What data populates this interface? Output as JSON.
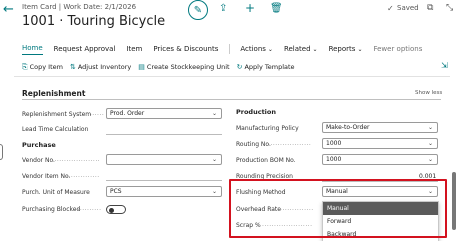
{
  "header": {
    "breadcrumb": "Item Card | Work Date: 2/1/2026",
    "title": "1001 · Touring Bicycle",
    "saved_label": "Saved"
  },
  "actions": {
    "tabs": [
      "Home",
      "Request Approval",
      "Item",
      "Prices & Discounts"
    ],
    "menus": [
      "Actions",
      "Related",
      "Reports"
    ],
    "fewer": "Fewer options"
  },
  "promoted": [
    "Copy Item",
    "Adjust Inventory",
    "Create Stockkeeping Unit",
    "Apply Template"
  ],
  "section": {
    "title": "Replenishment",
    "show_less": "Show less"
  },
  "left": {
    "replenishment_system": {
      "label": "Replenishment System",
      "value": "Prod. Order"
    },
    "lead_time": {
      "label": "Lead Time Calculation"
    },
    "purchase_heading": "Purchase",
    "vendor_no": {
      "label": "Vendor No."
    },
    "vendor_item_no": {
      "label": "Vendor Item No."
    },
    "purch_uom": {
      "label": "Purch. Unit of Measure",
      "value": "PCS"
    },
    "purchasing_blocked": {
      "label": "Purchasing Blocked",
      "value": false
    }
  },
  "right": {
    "production_heading": "Production",
    "manufacturing_policy": {
      "label": "Manufacturing Policy",
      "value": "Make-to-Order"
    },
    "routing_no": {
      "label": "Routing No.",
      "value": "1000"
    },
    "production_bom_no": {
      "label": "Production BOM No.",
      "value": "1000"
    },
    "rounding_precision": {
      "label": "Rounding Precision",
      "value": "0.001"
    },
    "flushing_method": {
      "label": "Flushing Method",
      "value": "Manual"
    },
    "overhead_rate": {
      "label": "Overhead Rate"
    },
    "scrap": {
      "label": "Scrap %"
    }
  },
  "dropdown": {
    "options": [
      "Manual",
      "Forward",
      "Backward"
    ],
    "selected": "Manual"
  },
  "colors": {
    "accent": "#00797f",
    "highlight_box": "#d3121f",
    "selected_option_bg": "#5a5a5a"
  },
  "icons": [
    "back-arrow-icon",
    "edit-icon",
    "share-icon",
    "add-icon",
    "delete-icon",
    "check-icon",
    "open-new-window-icon",
    "collapse-icon",
    "copy-icon",
    "adjust-icon",
    "stockkeeping-icon",
    "template-icon",
    "pin-icon",
    "chevron-down-icon"
  ]
}
